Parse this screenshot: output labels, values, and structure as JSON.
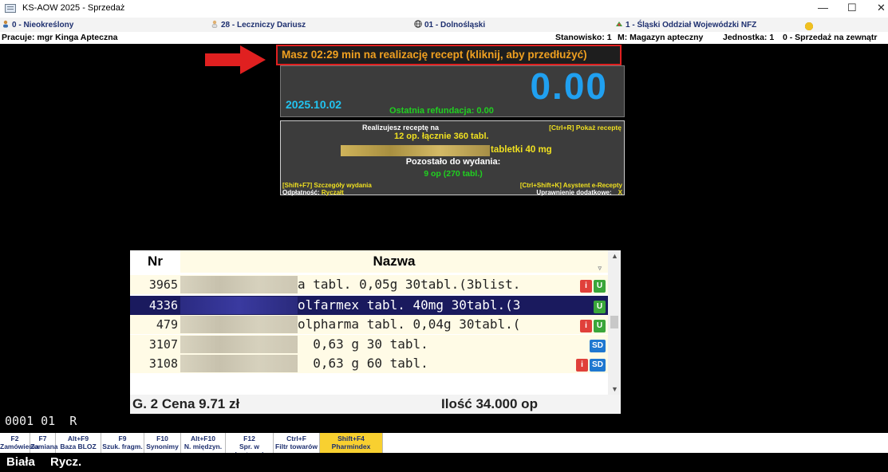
{
  "window": {
    "title": "KS-AOW 2025 - Sprzedaż",
    "minimize": "—",
    "maximize": "☐",
    "close": "✕"
  },
  "infobar": {
    "patient": "0 - Nieokreślony",
    "doctor": "28 - Leczniczy Dariusz",
    "region": "01 - Dolnośląski",
    "nfz": "1 - Śląski Oddział Wojewódzki NFZ",
    "status_colors": [
      "#2bb52b",
      "#2bb52b",
      "#e03030",
      "#f0c020",
      "#f0c020"
    ]
  },
  "workbar": {
    "user": "Pracuje: mgr Kinga Apteczna",
    "station": "Stanowisko: 1",
    "magazine": "M: Magazyn apteczny",
    "unit": "Jednostka: 1",
    "sale": "0 - Sprzedaż na zewnątr"
  },
  "timer": {
    "text": "Masz 02:29 min na realizację recept (kliknij, aby przedłużyć)"
  },
  "summary": {
    "amount": "0.00",
    "date": "2025.10.02",
    "last_refund": "Ostatnia refundacja: 0.00"
  },
  "rx": {
    "title": "Realizujesz receptę na",
    "show_shortcut": "[Ctrl+R] Pokaż receptę",
    "total": "12 op. łącznie 360 tabl.",
    "drug_suffix": "tabletki 40 mg",
    "remaining_label": "Pozostało do wydania:",
    "remaining": "9 op (270 tabl.)",
    "details_shortcut": "[Shift+F7] Szczegóły wydania",
    "assistant_shortcut": "[Ctrl+Shift+K] Asystent e-Recepty",
    "payment_label": "Odpłatność:",
    "payment_value": "Ryczałt",
    "permission_label": "Uprawnienie dodatkowe:",
    "permission_value": "X"
  },
  "grid": {
    "headers": {
      "nr": "Nr",
      "name": "Nazwa"
    },
    "rows": [
      {
        "nr": "3965",
        "name": "a tabl. 0,05g 30tabl.(3blist.",
        "badges": [
          "i",
          "U"
        ]
      },
      {
        "nr": "4336",
        "name": "olfarmex tabl. 40mg 30tabl.(3",
        "badges": [
          "U"
        ]
      },
      {
        "nr": "479",
        "name": "olpharma tabl. 0,04g 30tabl.(",
        "badges": [
          "i",
          "U"
        ]
      },
      {
        "nr": "3107",
        "name": "  0,63 g 30 tabl.",
        "badges": [
          "SD"
        ]
      },
      {
        "nr": "3108",
        "name": "  0,63 g 60 tabl.",
        "badges": [
          "i",
          "SD"
        ]
      }
    ],
    "footer": {
      "group_price": "G. 2  Cena 9.71 zł",
      "quantity": "Ilość 34.000 op"
    }
  },
  "code_line": "0001 01  R",
  "fkeys": [
    {
      "key": "F2",
      "label": "Zamówienia"
    },
    {
      "key": "F7",
      "label": "Zamiana"
    },
    {
      "key": "Alt+F9",
      "label": "Baza BLOZ"
    },
    {
      "key": "F9",
      "label": "Szuk. fragm."
    },
    {
      "key": "F10",
      "label": "Synonimy"
    },
    {
      "key": "Alt+F10",
      "label": "N. międzyn."
    },
    {
      "key": "F12",
      "label": "Spr. w hurtowni"
    },
    {
      "key": "Ctrl+F",
      "label": "Filtr towarów"
    },
    {
      "key": "Shift+F4",
      "label": "Pharmindex"
    }
  ],
  "status": {
    "left": "Biała",
    "right": "Rycz."
  }
}
